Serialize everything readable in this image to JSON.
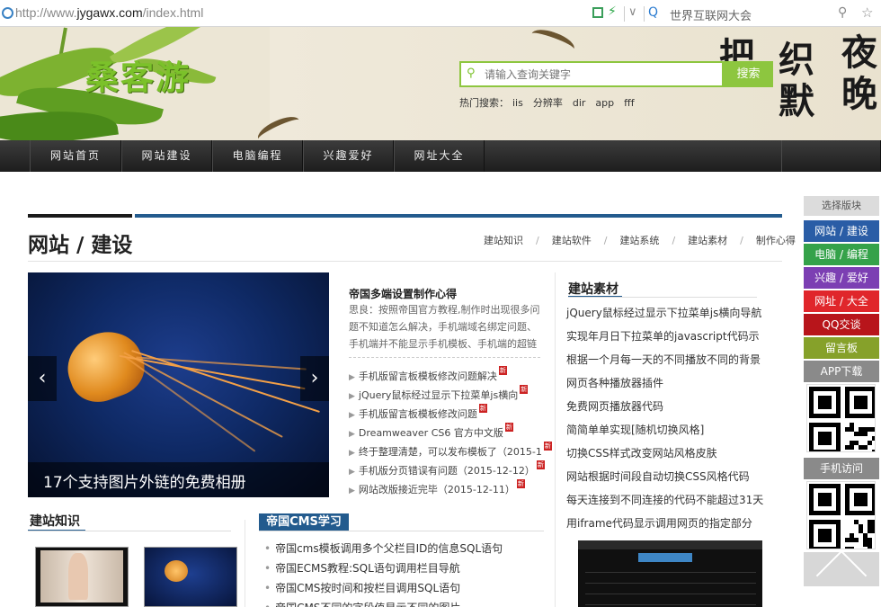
{
  "browser": {
    "url_prefix": "http://www.",
    "url_host": "jygawx.com",
    "url_path": "/index.html",
    "search_hint": "世界互联网大会"
  },
  "header": {
    "logo_text": "桑客游",
    "calligraphy": [
      "夜",
      "晚",
      "织",
      "默",
      "把"
    ],
    "search_placeholder": "请输入查询关键字",
    "search_button": "搜索",
    "hot_label": "热门搜索：",
    "hot_terms": [
      "iis",
      "分辨率",
      "dir",
      "app",
      "fff"
    ]
  },
  "nav": {
    "items": [
      "网站首页",
      "网站建设",
      "电脑编程",
      "兴趣爱好",
      "网址大全"
    ]
  },
  "section": {
    "title": "网站 / 建设",
    "subnav": [
      "建站知识",
      "建站软件",
      "建站系统",
      "建站素材",
      "制作心得"
    ]
  },
  "slider": {
    "caption": "17个支持图片外链的免费相册",
    "prev": "‹",
    "next": "›"
  },
  "featured": {
    "title": "帝国多端设置制作心得",
    "desc": "思良：按照帝国官方教程,制作时出现很多问题不知道怎么解决，手机端域名绑定问题、手机端并不能显示手机模板、手机端的超链接，链接"
  },
  "article_list": [
    {
      "text": "手机版留言板模板修改问题解决",
      "new": true
    },
    {
      "text": "jQuery鼠标经过显示下拉菜单js横向",
      "new": true
    },
    {
      "text": "手机版留言板模板修改问题",
      "new": true
    },
    {
      "text": "Dreamweaver CS6 官方中文版",
      "new": true
    },
    {
      "text": "终于整理清楚，可以发布模板了（2015-1",
      "new": true
    },
    {
      "text": "手机版分页错误有问题（2015-12-12）",
      "new": true
    },
    {
      "text": "网站改版接近完毕（2015-12-11）",
      "new": true
    }
  ],
  "new_badge": "新",
  "materials": {
    "title": "建站素材",
    "items": [
      "jQuery鼠标经过显示下拉菜单js横向导航",
      "实现年月日下拉菜单的javascript代码示",
      "根据一个月每一天的不同播放不同的背景",
      "网页各种播放器插件",
      "免费网页播放器代码",
      "简简单单实现[随机切换风格]",
      "切换CSS样式改变网站风格皮肤",
      "网站根据时间段自动切换CSS风格代码",
      "每天连接到不同连接的代码不能超过31天",
      "用iframe代码显示调用网页的指定部分"
    ]
  },
  "knowledge": {
    "title": "建站知识"
  },
  "cms": {
    "title": "帝国CMS学习",
    "items": [
      "帝国cms模板调用多个父栏目ID的信息SQL语句",
      "帝国ECMS教程:SQL语句调用栏目导航",
      "帝国CMS按时间和按栏目调用SQL语句",
      "帝国CMS不同的字段值显示不同的图片"
    ]
  },
  "float_side": {
    "header": "选择版块",
    "buttons": [
      {
        "label": "网站 / 建设",
        "color": "#2a5da6"
      },
      {
        "label": "电脑 / 编程",
        "color": "#35a24a"
      },
      {
        "label": "兴趣 / 爱好",
        "color": "#7c3fb3"
      },
      {
        "label": "网址 / 大全",
        "color": "#e0262b"
      },
      {
        "label": "QQ交谈",
        "color": "#b8151b"
      },
      {
        "label": "留言板",
        "color": "#86a12a"
      },
      {
        "label": "APP下载",
        "color": "#8a8a8a"
      },
      {
        "label": "手机访问",
        "color": "#8a8a8a"
      }
    ]
  }
}
